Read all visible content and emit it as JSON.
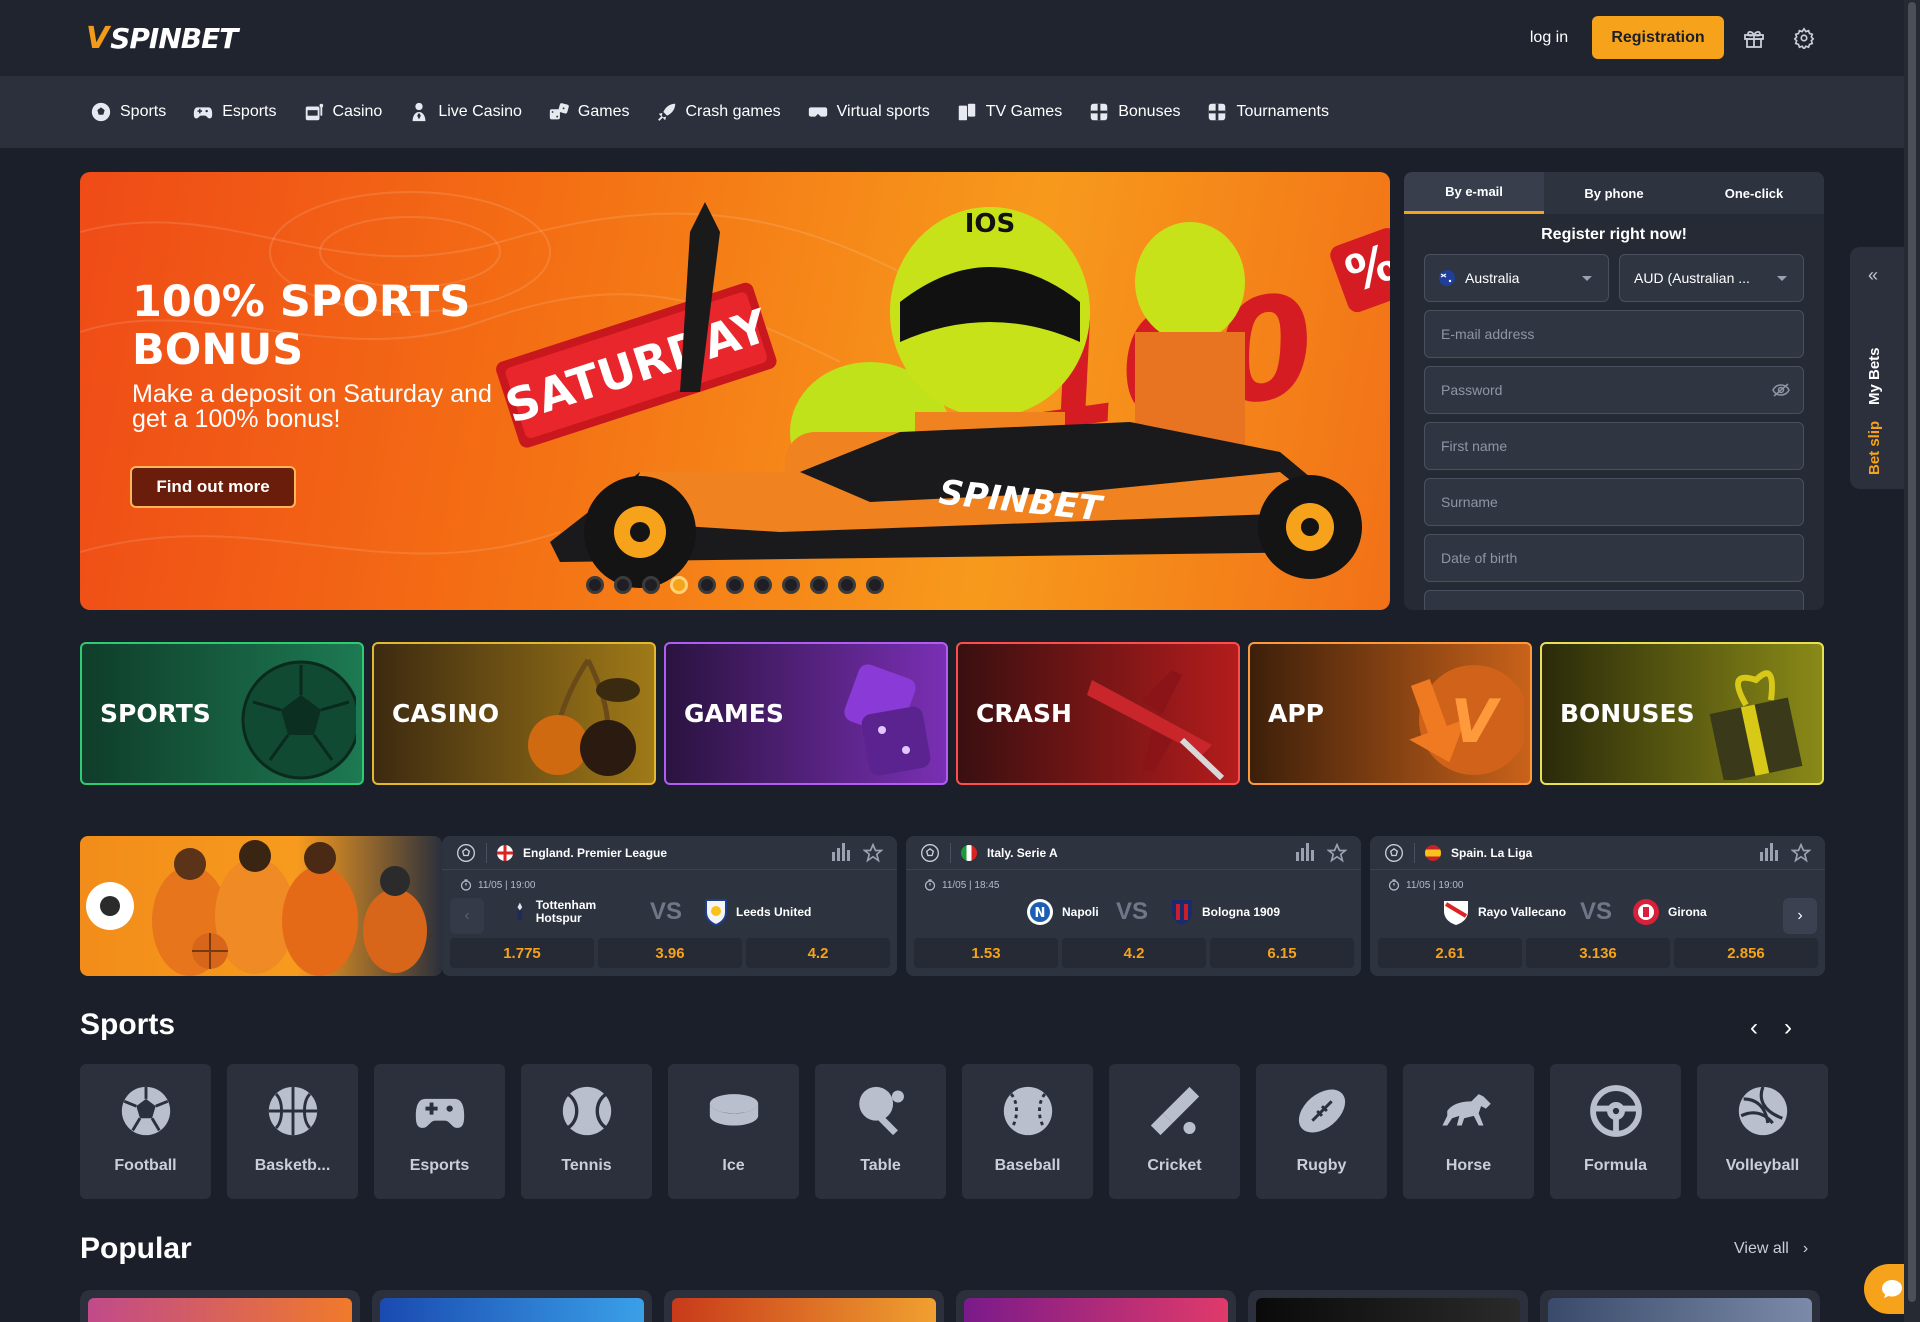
{
  "header": {
    "logo_mark": "V",
    "logo_text": "SPINBET",
    "login_label": "log in",
    "register_label": "Registration"
  },
  "nav": {
    "items": [
      {
        "label": "Sports",
        "icon": "soccer-ball-icon"
      },
      {
        "label": "Esports",
        "icon": "gamepad-icon"
      },
      {
        "label": "Casino",
        "icon": "slot-machine-icon"
      },
      {
        "label": "Live Casino",
        "icon": "dealer-icon"
      },
      {
        "label": "Games",
        "icon": "dice-icon"
      },
      {
        "label": "Crash games",
        "icon": "rocket-icon"
      },
      {
        "label": "Virtual sports",
        "icon": "vr-headset-icon"
      },
      {
        "label": "TV Games",
        "icon": "tv-cards-icon"
      },
      {
        "label": "Bonuses",
        "icon": "gift-icon"
      },
      {
        "label": "Tournaments",
        "icon": "trophy-icon"
      }
    ]
  },
  "banner": {
    "title": "100% SPORTS BONUS",
    "subtitle": "Make a deposit on Saturday and get a 100% bonus!",
    "cta": "Find out more",
    "slides_total": 11,
    "active_slide_index": 3,
    "art_words": {
      "day": "SATURDAY",
      "percent": "100",
      "helmet": "IOS",
      "car": "SPINBET"
    }
  },
  "registration": {
    "tabs": [
      "By e-mail",
      "By phone",
      "One-click"
    ],
    "active_tab": "By e-mail",
    "title": "Register right now!",
    "country": "Australia",
    "currency": "AUD (Australian ...",
    "placeholders": {
      "email": "E-mail address",
      "password": "Password",
      "first_name": "First name",
      "surname": "Surname",
      "dob": "Date of birth"
    }
  },
  "sidetab": {
    "my_bets": "My Bets",
    "bet_slip": "Bet slip"
  },
  "tiles": [
    {
      "label": "SPORTS",
      "colors": [
        "#0f3d2a",
        "#1d7a52"
      ],
      "border": "#2ecc71"
    },
    {
      "label": "CASINO",
      "colors": [
        "#3d2a10",
        "#a07a18"
      ],
      "border": "#e1b830"
    },
    {
      "label": "GAMES",
      "colors": [
        "#2a1340",
        "#7a2fb4"
      ],
      "border": "#b35cf5"
    },
    {
      "label": "CRASH",
      "colors": [
        "#3a0f10",
        "#b41c1c"
      ],
      "border": "#ff4d4d"
    },
    {
      "label": "APP",
      "colors": [
        "#3d1f0a",
        "#c9621a"
      ],
      "border": "#ff9a3c"
    },
    {
      "label": "BONUSES",
      "colors": [
        "#2a2a0a",
        "#8a8a18"
      ],
      "border": "#e8e052"
    }
  ],
  "matches": [
    {
      "league": "England. Premier League",
      "time": "11/05 | 19:00",
      "home": "Tottenham Hotspur",
      "away": "Leeds United",
      "odds": [
        "1.775",
        "3.96",
        "4.2"
      ]
    },
    {
      "league": "Italy. Serie A",
      "time": "11/05 | 18:45",
      "home": "Napoli",
      "away": "Bologna 1909",
      "odds": [
        "1.53",
        "4.2",
        "6.15"
      ]
    },
    {
      "league": "Spain. La Liga",
      "time": "11/05 | 19:00",
      "home": "Rayo Vallecano",
      "away": "Girona",
      "odds": [
        "2.61",
        "3.136",
        "2.856"
      ]
    }
  ],
  "vs_label": "VS",
  "sports": {
    "title": "Sports",
    "items": [
      "Football",
      "Basketb...",
      "Esports",
      "Tennis",
      "Ice",
      "Table",
      "Baseball",
      "Cricket",
      "Rugby",
      "Horse",
      "Formula",
      "Volleyball"
    ]
  },
  "popular": {
    "title": "Popular",
    "view_all": "View all"
  }
}
